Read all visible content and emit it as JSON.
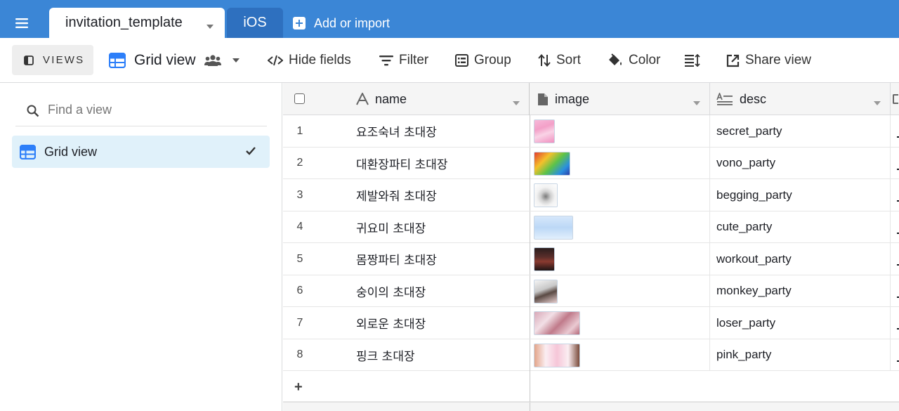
{
  "tabs": {
    "active": "invitation_template",
    "second": "iOS",
    "add_label": "Add or import"
  },
  "toolbar": {
    "views_label": "VIEWS",
    "view_name": "Grid view",
    "hide_fields": "Hide fields",
    "filter": "Filter",
    "group": "Group",
    "sort": "Sort",
    "color": "Color",
    "share_view": "Share view"
  },
  "sidebar": {
    "search_placeholder": "Find a view",
    "views": [
      {
        "label": "Grid view",
        "selected": true
      }
    ]
  },
  "colors": {
    "tabbar": "#3b86d6",
    "tab_inactive": "#2e70bf",
    "accent": "#2d7ff9",
    "selected_bg": "#e0f1fa"
  },
  "grid": {
    "columns": [
      {
        "label": "name",
        "icon": "text-A-icon"
      },
      {
        "label": "image",
        "icon": "file-icon"
      },
      {
        "label": "desc",
        "icon": "long-text-icon"
      }
    ],
    "rows": [
      {
        "num": "1",
        "name": "요조숙녀 초대장",
        "desc": "secret_party"
      },
      {
        "num": "2",
        "name": "대환장파티 초대장",
        "desc": "vono_party"
      },
      {
        "num": "3",
        "name": "제발와줘 초대장",
        "desc": "begging_party"
      },
      {
        "num": "4",
        "name": "귀요미 초대장",
        "desc": "cute_party"
      },
      {
        "num": "5",
        "name": "몸짱파티 초대장",
        "desc": "workout_party"
      },
      {
        "num": "6",
        "name": "숭이의 초대장",
        "desc": "monkey_party"
      },
      {
        "num": "7",
        "name": "외로운 초대장",
        "desc": "loser_party"
      },
      {
        "num": "8",
        "name": "핑크 초대장",
        "desc": "pink_party"
      }
    ],
    "add_row_label": "+"
  }
}
